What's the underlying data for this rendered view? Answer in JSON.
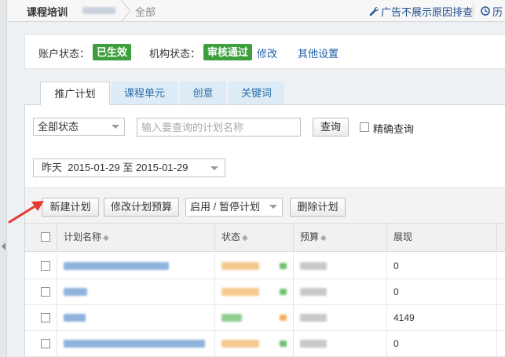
{
  "header": {
    "breadcrumb_root": "课程培训",
    "breadcrumb_current": "全部",
    "link_ads_issue": "广告不展示原因排查",
    "link_history": "历"
  },
  "account_status": {
    "account_label": "账户状态：",
    "account_badge": "已生效",
    "org_label": "机构状态：",
    "org_badge": "审核通过",
    "modify_link": "修改",
    "other_settings": "其他设置"
  },
  "tabs": [
    {
      "label": "推广计划",
      "active": true
    },
    {
      "label": "课程单元",
      "active": false
    },
    {
      "label": "创意",
      "active": false
    },
    {
      "label": "关键词",
      "active": false
    }
  ],
  "filters": {
    "status_select": "全部状态",
    "search_placeholder": "输入要查询的计划名称",
    "search_button": "查询",
    "exact_match_label": "精确查询",
    "date_range": "昨天  2015-01-29 至 2015-01-29"
  },
  "toolbar": {
    "new_plan": "新建计划",
    "modify_budget": "修改计划预算",
    "toggle_plan": "启用 / 暂停计划",
    "delete_plan": "删除计划"
  },
  "table": {
    "columns": [
      "计划名称",
      "状态",
      "预算",
      "展现"
    ],
    "rows": [
      {
        "impressions": "0"
      },
      {
        "impressions": "0"
      },
      {
        "impressions": "4149"
      },
      {
        "impressions": "0"
      }
    ]
  },
  "colors": {
    "link": "#1f5fa8",
    "badge_green": "#3c9f3c",
    "tab_inactive_bg": "#dcebf6",
    "arrow_red": "#e53a2f"
  }
}
